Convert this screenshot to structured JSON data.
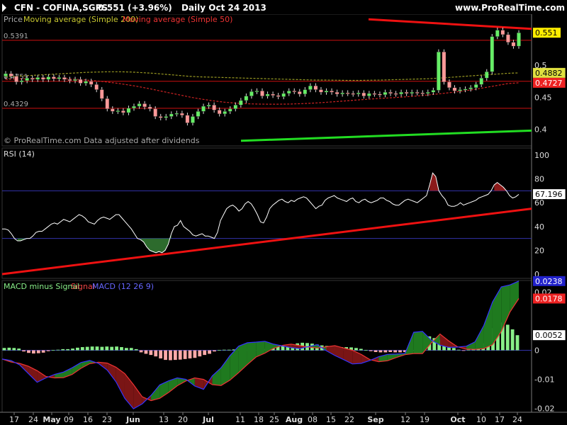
{
  "header": {
    "symbol": "CFN - COFINA,SGPS",
    "price_change": "0.551 (+3.96%)",
    "period_date": "Daily  Oct 24 2013",
    "site": "www.ProRealTime.com"
  },
  "price_panel": {
    "legend_price": "Price",
    "legend_ma200": "Moving average (Simple 200)",
    "legend_ma50": "Moving average (Simple 50)",
    "footer": "© ProRealTime.com  Data adjusted after dividends",
    "level_labels": [
      "0.5391",
      "0.4751",
      "0.4329"
    ],
    "last_price_label": "0.551",
    "ma200_label": "0.4882",
    "ma50_label": "0.4727",
    "axis_labels": [
      "0.5",
      "0.45",
      "0.4"
    ]
  },
  "rsi_panel": {
    "title": "RSI (14)",
    "value_label": "67.196",
    "axis_labels": [
      "100",
      "80",
      "60",
      "40",
      "20",
      "0"
    ]
  },
  "macd_panel": {
    "legend_hist": "MACD minus Signal",
    "legend_signal": "Signal",
    "legend_macd": "MACD (12 26 9)",
    "macd_label": "0.0238",
    "signal_label": "0.0178",
    "hist_label": "0.0052",
    "extra_label": "0.02",
    "axis_labels": [
      "0",
      "-0.01",
      "-0.02"
    ]
  },
  "x_axis": {
    "labels": [
      "17",
      "24",
      "May",
      "09",
      "16",
      "23",
      "Jun",
      "13",
      "20",
      "Jul",
      "11",
      "18",
      "25",
      "Aug",
      "08",
      "15",
      "22",
      "Sep",
      "12",
      "19",
      "Oct",
      "10",
      "17",
      "24"
    ]
  },
  "colors": {
    "background": "#000000",
    "up_candle": "#66ee66",
    "down_candle": "#ff9999",
    "ma200": "#999922",
    "ma50": "#cc2222",
    "support_line": "#22dd22",
    "trend_line": "#ee1111",
    "rsi_line": "#ffffff",
    "macd_line": "#3333ff",
    "signal_line": "#ee3333"
  },
  "chart_data": [
    {
      "type": "candlestick",
      "title": "CFN - COFINA,SGPS",
      "series": [
        {
          "name": "Price",
          "values": [
            0.487,
            0.483,
            0.474,
            0.476,
            0.48,
            0.478,
            0.481,
            0.478,
            0.482,
            0.479,
            0.481,
            0.478,
            0.476,
            0.478,
            0.472,
            0.475,
            0.47,
            0.462,
            0.448,
            0.432,
            0.428,
            0.429,
            0.426,
            0.433,
            0.436,
            0.44,
            0.435,
            0.432,
            0.42,
            0.418,
            0.42,
            0.424,
            0.425,
            0.422,
            0.41,
            0.42,
            0.428,
            0.436,
            0.438,
            0.43,
            0.424,
            0.428,
            0.432,
            0.438,
            0.445,
            0.452,
            0.459,
            0.46,
            0.452,
            0.455,
            0.453,
            0.451,
            0.456,
            0.46,
            0.459,
            0.455,
            0.462,
            0.468,
            0.462,
            0.458,
            0.46,
            0.458,
            0.455,
            0.457,
            0.456,
            0.455,
            0.457,
            0.452,
            0.456,
            0.455,
            0.454,
            0.458,
            0.456,
            0.455,
            0.458,
            0.456,
            0.458,
            0.457,
            0.456,
            0.458,
            0.461,
            0.521,
            0.474,
            0.465,
            0.46,
            0.462,
            0.463,
            0.465,
            0.47,
            0.48,
            0.49,
            0.545,
            0.555,
            0.548,
            0.536,
            0.53,
            0.551
          ]
        },
        {
          "name": "Moving average (Simple 200)",
          "values": [
            0.482,
            0.483,
            0.484,
            0.485,
            0.486,
            0.487,
            0.488,
            0.489,
            0.4895,
            0.49,
            0.49,
            0.4895,
            0.4885,
            0.4875,
            0.486,
            0.4845,
            0.483,
            0.482,
            0.4815,
            0.481,
            0.4805,
            0.48,
            0.4795,
            0.479,
            0.4785,
            0.478,
            0.4775,
            0.477,
            0.477,
            0.4768,
            0.4765,
            0.4765,
            0.4768,
            0.477,
            0.4775,
            0.478,
            0.4785,
            0.479,
            0.48,
            0.4812,
            0.4825,
            0.4838,
            0.485,
            0.4862,
            0.4875,
            0.4882
          ]
        },
        {
          "name": "Moving average (Simple 50)",
          "values": [
            0.478,
            0.4788,
            0.4792,
            0.4795,
            0.4795,
            0.4792,
            0.4785,
            0.4775,
            0.4762,
            0.4745,
            0.4725,
            0.47,
            0.4672,
            0.464,
            0.4605,
            0.457,
            0.4535,
            0.45,
            0.447,
            0.4445,
            0.4425,
            0.441,
            0.44,
            0.4395,
            0.4392,
            0.4392,
            0.4395,
            0.44,
            0.4408,
            0.4418,
            0.443,
            0.4442,
            0.4455,
            0.4468,
            0.448,
            0.449,
            0.45,
            0.4512,
            0.4525,
            0.4542,
            0.456,
            0.458,
            0.46,
            0.4625,
            0.4655,
            0.4685,
            0.4715,
            0.4727
          ]
        },
        {
          "name": "Support",
          "values": [
            0.382,
            0.398
          ]
        },
        {
          "name": "Resistance",
          "values": [
            0.572,
            0.557
          ]
        }
      ],
      "levels": [
        0.5391,
        0.4751,
        0.4329
      ],
      "ylim": [
        0.374,
        0.58
      ]
    },
    {
      "type": "line",
      "title": "RSI (14)",
      "series": [
        {
          "name": "RSI (14)",
          "values": [
            38,
            38,
            37,
            34,
            30,
            28,
            28,
            29,
            30,
            30,
            32,
            35,
            36,
            36,
            38,
            40,
            42,
            43,
            42,
            44,
            46,
            45,
            44,
            46,
            48,
            50,
            49,
            47,
            44,
            43,
            42,
            45,
            47,
            48,
            47,
            46,
            48,
            50,
            50,
            47,
            44,
            41,
            38,
            34,
            30,
            29,
            27,
            23,
            20,
            19,
            18,
            19,
            18,
            20,
            25,
            34,
            40,
            41,
            45,
            40,
            38,
            36,
            33,
            32,
            33,
            34,
            32,
            32,
            31,
            30,
            35,
            45,
            50,
            55,
            57,
            58,
            56,
            53,
            55,
            59,
            61,
            59,
            55,
            50,
            44,
            43,
            48,
            55,
            58,
            60,
            62,
            63,
            61,
            60,
            62,
            61,
            63,
            64,
            65,
            64,
            61,
            58,
            55,
            57,
            58,
            62,
            64,
            65,
            66,
            64,
            63,
            62,
            61,
            63,
            64,
            61,
            60,
            62,
            63,
            61,
            60,
            61,
            62,
            64,
            64,
            62,
            61,
            59,
            58,
            58,
            60,
            62,
            63,
            62,
            61,
            60,
            62,
            64,
            66,
            75,
            85,
            82,
            70,
            66,
            63,
            58,
            57,
            57,
            58,
            60,
            58,
            59,
            60,
            61,
            62,
            64,
            65,
            66,
            67,
            70,
            75,
            77,
            75,
            73,
            70,
            66,
            64,
            65,
            67
          ]
        },
        {
          "name": "Trend",
          "values": [
            0,
            55
          ]
        }
      ],
      "levels": [
        70,
        30
      ],
      "ylim": [
        0,
        100
      ]
    },
    {
      "type": "bar",
      "title": "MACD (12 26 9)",
      "series": [
        {
          "name": "MACD minus Signal",
          "values": [
            0.0008,
            0.0009,
            0.0008,
            0.0006,
            -0.0004,
            -0.0009,
            -0.0011,
            -0.001,
            -0.0008,
            -0.0003,
            0.0001,
            0.0002,
            0.0004,
            0.0004,
            0.0006,
            0.0009,
            0.0011,
            0.0012,
            0.0013,
            0.0013,
            0.0012,
            0.0013,
            0.0012,
            0.0013,
            0.0011,
            0.0008,
            0.0008,
            0.0004,
            -0.0007,
            -0.0012,
            -0.0016,
            -0.0021,
            -0.0028,
            -0.0033,
            -0.0034,
            -0.0033,
            -0.0032,
            -0.003,
            -0.0028,
            -0.0026,
            -0.0021,
            -0.0016,
            -0.0012,
            -0.0004,
            0.0001,
            0.0002,
            0.0002,
            0.0003,
            0.0004,
            0.0004,
            0.0002,
            0.0001,
            0.0003,
            0.0005,
            0.0009,
            0.0012,
            0.0015,
            0.0016,
            0.0018,
            0.0021,
            0.0024,
            0.0026,
            0.0025,
            0.0023,
            0.002,
            0.0017,
            0.0015,
            0.0013,
            0.0013,
            0.0011,
            0.0011,
            0.001,
            0.0008,
            0.0005,
            0.0001,
            -0.0003,
            -0.0006,
            -0.0007,
            -0.0007,
            -0.0006,
            -0.0007,
            -0.0007,
            -0.0006,
            -0.0003,
            0.0,
            0.0005,
            0.0052,
            0.0048,
            0.0042,
            0.0036,
            0.0024,
            0.0014,
            0.0008,
            0.0002,
            -0.0001,
            0.0002,
            0.0006,
            0.0012,
            0.0024,
            0.0046,
            0.0076,
            0.0093,
            0.0096,
            0.0088,
            0.0072,
            0.0052
          ]
        },
        {
          "name": "Signal",
          "values": [
            -0.003,
            -0.004,
            -0.0045,
            -0.0055,
            -0.007,
            -0.009,
            -0.0095,
            -0.0094,
            -0.0083,
            -0.0062,
            -0.0046,
            -0.0041,
            -0.0044,
            -0.0058,
            -0.008,
            -0.0118,
            -0.016,
            -0.0173,
            -0.0165,
            -0.0145,
            -0.0122,
            -0.0105,
            -0.0095,
            -0.01,
            -0.0118,
            -0.0121,
            -0.0103,
            -0.0077,
            -0.0049,
            -0.0023,
            -0.001,
            0.0007,
            0.0017,
            0.0021,
            0.0016,
            0.0011,
            0.0008,
            0.0012,
            0.0016,
            0.0008,
            0.0,
            -0.0014,
            -0.0032,
            -0.0039,
            -0.0036,
            -0.0025,
            -0.0015,
            -0.0011,
            -0.0011,
            0.0025,
            0.0056,
            0.0032,
            0.0012,
            0.0004,
            0.0003,
            0.0006,
            0.0019,
            0.0065,
            0.0132,
            0.0178
          ]
        },
        {
          "name": "MACD (12 26 9)",
          "values": [
            -0.003,
            -0.0035,
            -0.005,
            -0.008,
            -0.011,
            -0.0095,
            -0.0083,
            -0.0075,
            -0.006,
            -0.0042,
            -0.0035,
            -0.0045,
            -0.0068,
            -0.0108,
            -0.0165,
            -0.0201,
            -0.0184,
            -0.0155,
            -0.0119,
            -0.0105,
            -0.0095,
            -0.01,
            -0.0123,
            -0.0134,
            -0.0088,
            -0.006,
            -0.0019,
            0.0014,
            0.0026,
            0.0028,
            0.0031,
            0.0021,
            0.0015,
            0.0009,
            0.0006,
            0.0013,
            0.0019,
            -0.0001,
            -0.0018,
            -0.0032,
            -0.0047,
            -0.0045,
            -0.0035,
            -0.0022,
            -0.0014,
            -0.0013,
            -0.0011,
            0.0062,
            0.0065,
            0.0035,
            0.0018,
            0.001,
            0.0011,
            0.0014,
            0.0029,
            0.0085,
            0.0166,
            0.0218,
            0.0225,
            0.0238
          ]
        }
      ],
      "ylim": [
        -0.0213,
        0.024
      ]
    }
  ]
}
